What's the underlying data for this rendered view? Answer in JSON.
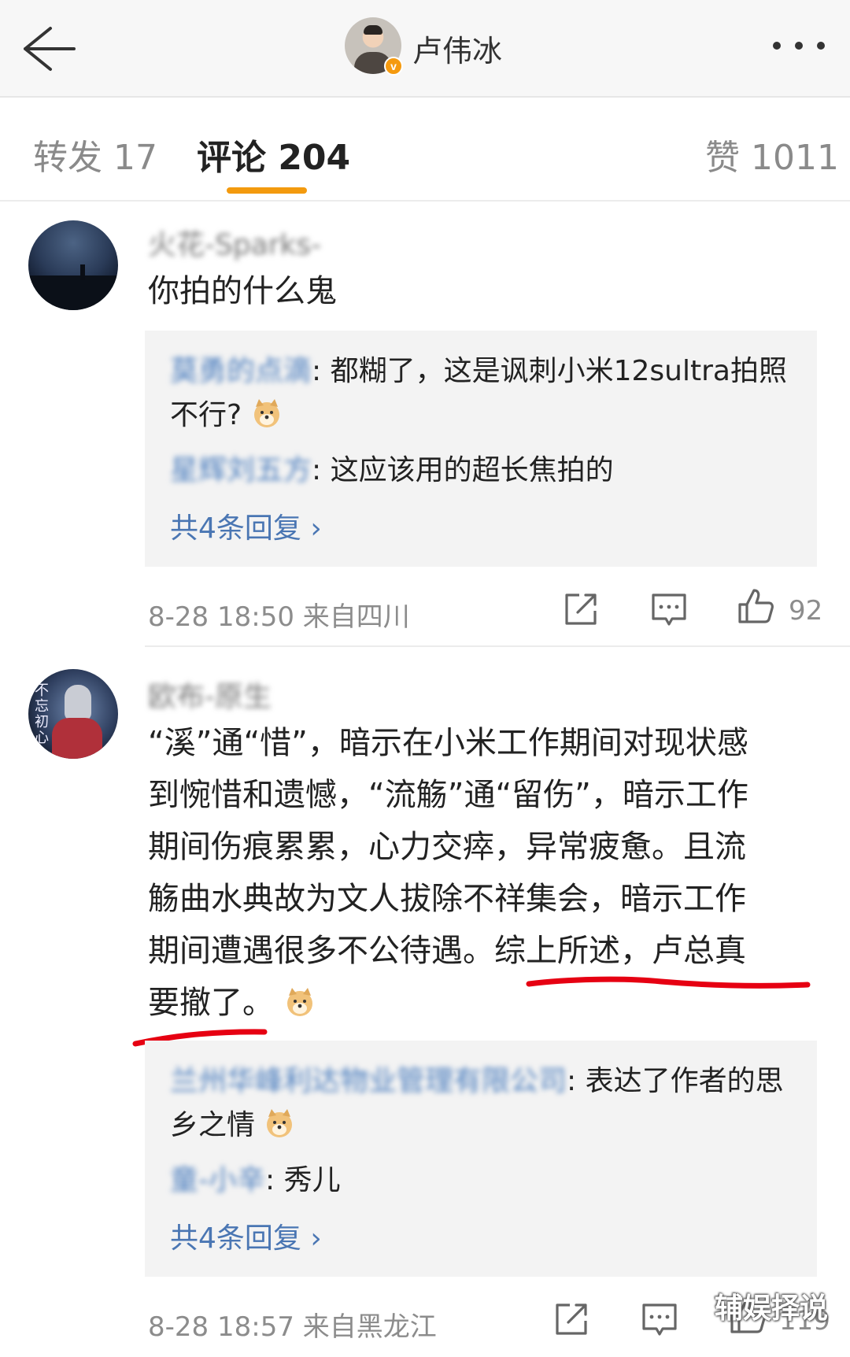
{
  "header": {
    "title": "卢伟冰",
    "verified_badge": "v"
  },
  "tabs": [
    {
      "label": "转发 17"
    },
    {
      "label": "评论 204"
    },
    {
      "label": "赞 1011"
    }
  ],
  "colors": {
    "accent": "#f39a0e",
    "link": "#4a76b3",
    "annotation": "#e60012"
  },
  "comments": [
    {
      "username": "火花-Sparks-",
      "text": "你拍的什么鬼",
      "replies": [
        {
          "user": "莫勇的点滴",
          "text": ": 都糊了，这是讽刺小米12sultra拍照不行?"
        },
        {
          "user": "星辉刘五方",
          "text": ": 这应该用的超长焦拍的"
        }
      ],
      "more_replies": "共4条回复 ›",
      "time_location": "8-28 18:50  来自四川",
      "likes": "92"
    },
    {
      "username": "欧布-原生",
      "avatar_caption": "不忘初心",
      "text_lines": [
        "“溪”通“惜”，暗示在小米工作期间对现状感",
        "到惋惜和遗憾，“流觞”通“留伤”，暗示工作",
        "期间伤痕累累，心力交瘁，异常疲惫。且流",
        "觞曲水典故为文人拔除不祥集会，暗示工作",
        "期间遭遇很多不公待遇。综上所述，卢总真",
        "要撤了。"
      ],
      "replies": [
        {
          "user": "兰州华峰利达物业管理有限公司",
          "text": ": 表达了作者的思乡之情"
        },
        {
          "user": "童-小辛",
          "text": ": 秀儿"
        }
      ],
      "more_replies": "共4条回复 ›",
      "time_location": "8-28 18:57  来自黑龙江",
      "likes": "119"
    }
  ],
  "watermark": "辅娱择说"
}
